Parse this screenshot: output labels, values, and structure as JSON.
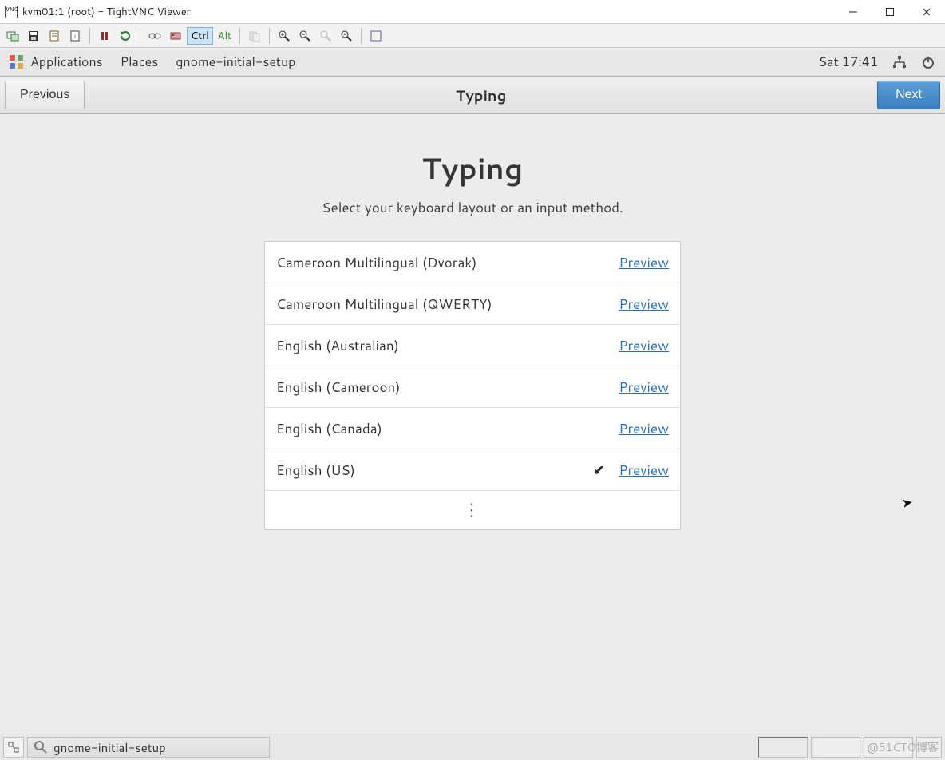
{
  "window": {
    "title": "kvm01:1 (root) - TightVNC Viewer",
    "app_icon_label": "VNC"
  },
  "vnc_toolbar": {
    "ctrl": "Ctrl",
    "alt": "Alt"
  },
  "gnome_top": {
    "applications": "Applications",
    "places": "Places",
    "app_name": "gnome-initial-setup",
    "clock": "Sat 17:41"
  },
  "setup_header": {
    "previous": "Previous",
    "title": "Typing",
    "next": "Next"
  },
  "page": {
    "heading": "Typing",
    "sub": "Select your keyboard layout or an input method."
  },
  "layouts": [
    {
      "name": "Cameroon Multilingual (Dvorak)",
      "selected": false,
      "preview": "Preview"
    },
    {
      "name": "Cameroon Multilingual (QWERTY)",
      "selected": false,
      "preview": "Preview"
    },
    {
      "name": "English (Australian)",
      "selected": false,
      "preview": "Preview"
    },
    {
      "name": "English (Cameroon)",
      "selected": false,
      "preview": "Preview"
    },
    {
      "name": "English (Canada)",
      "selected": false,
      "preview": "Preview"
    },
    {
      "name": "English (US)",
      "selected": true,
      "preview": "Preview"
    }
  ],
  "taskbar": {
    "app": "gnome-initial-setup"
  },
  "watermark": "@51CTO博客"
}
